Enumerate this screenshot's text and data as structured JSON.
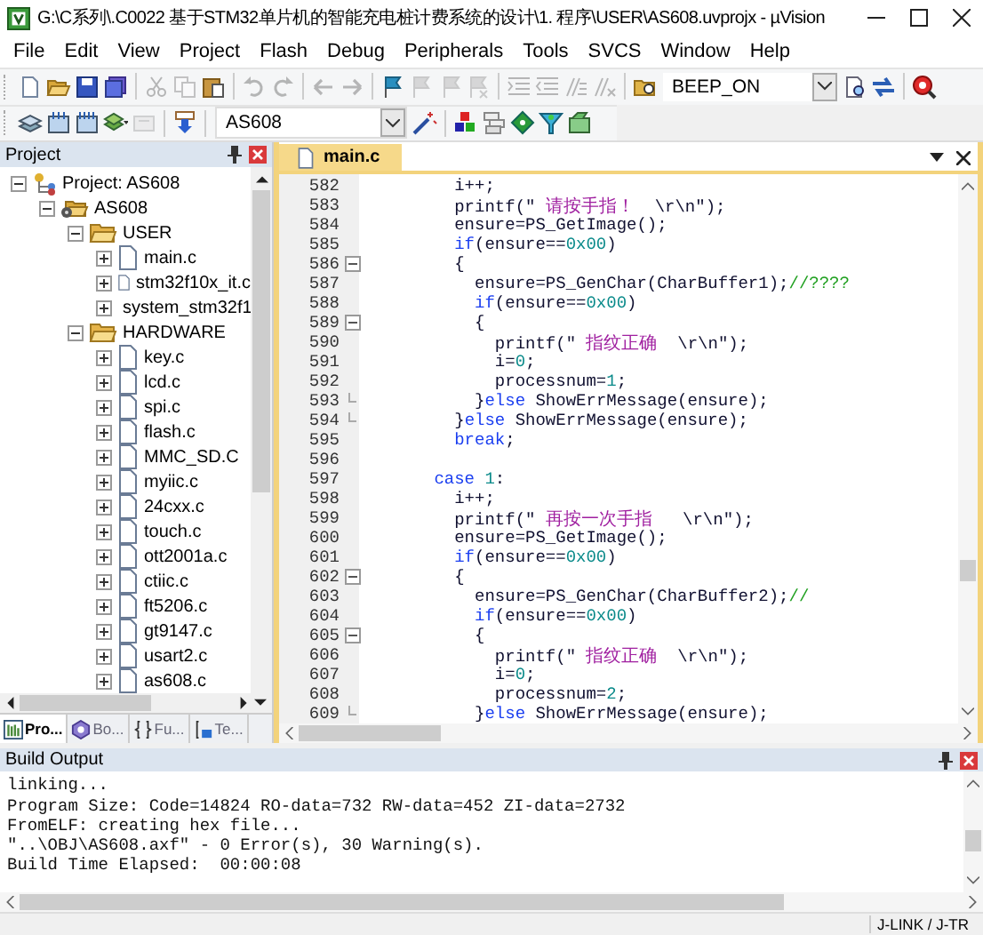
{
  "window": {
    "title": "G:\\C系列\\.C0022 基于STM32单片机的智能充电桩计费系统的设计\\1. 程序\\USER\\AS608.uvprojx - µVision"
  },
  "menu": [
    "File",
    "Edit",
    "View",
    "Project",
    "Flash",
    "Debug",
    "Peripherals",
    "Tools",
    "SVCS",
    "Window",
    "Help"
  ],
  "toolbar_1": [
    {
      "kind": "button",
      "disabled": false
    },
    {
      "kind": "button",
      "disabled": false
    },
    {
      "kind": "button",
      "disabled": false
    },
    {
      "kind": "button",
      "disabled": false
    },
    {
      "kind": "separator"
    },
    {
      "kind": "button",
      "disabled": true
    },
    {
      "kind": "button",
      "disabled": true
    },
    {
      "kind": "button",
      "disabled": false
    },
    {
      "kind": "separator"
    },
    {
      "kind": "button",
      "disabled": true
    },
    {
      "kind": "button",
      "disabled": true
    },
    {
      "kind": "separator"
    },
    {
      "kind": "button",
      "disabled": true
    },
    {
      "kind": "button",
      "disabled": true
    },
    {
      "kind": "separator"
    },
    {
      "kind": "button",
      "disabled": false
    },
    {
      "kind": "button",
      "disabled": true
    },
    {
      "kind": "button",
      "disabled": true
    },
    {
      "kind": "button",
      "disabled": true
    },
    {
      "kind": "separator"
    },
    {
      "kind": "button",
      "disabled": true
    },
    {
      "kind": "button",
      "disabled": true
    },
    {
      "kind": "button",
      "disabled": true
    },
    {
      "kind": "button",
      "disabled": true
    },
    {
      "kind": "separator"
    },
    {
      "kind": "button",
      "disabled": false
    },
    {
      "kind": "combo",
      "value": "BEEP_ON"
    },
    {
      "kind": "button",
      "disabled": false
    },
    {
      "kind": "button",
      "disabled": false
    },
    {
      "kind": "separator"
    },
    {
      "kind": "button",
      "disabled": false
    }
  ],
  "toolbar_2": [
    {
      "kind": "button",
      "disabled": false
    },
    {
      "kind": "button",
      "disabled": false
    },
    {
      "kind": "button",
      "disabled": false
    },
    {
      "kind": "button",
      "disabled": false
    },
    {
      "kind": "button",
      "disabled": true
    },
    {
      "kind": "separator"
    },
    {
      "kind": "button",
      "disabled": false
    },
    {
      "kind": "separator"
    },
    {
      "kind": "combo",
      "value": "AS608"
    },
    {
      "kind": "button",
      "disabled": false
    },
    {
      "kind": "separator"
    },
    {
      "kind": "button",
      "disabled": false
    },
    {
      "kind": "button",
      "disabled": false
    },
    {
      "kind": "button",
      "disabled": false
    },
    {
      "kind": "button",
      "disabled": false
    },
    {
      "kind": "button",
      "disabled": false
    }
  ],
  "project_panel": {
    "title": "Project",
    "tree": [
      {
        "label": "Project: AS608",
        "kind": "project",
        "expanded": true,
        "children": [
          {
            "label": "AS608",
            "kind": "target",
            "expanded": true,
            "children": [
              {
                "label": "USER",
                "kind": "folder",
                "expanded": true,
                "children": [
                  {
                    "label": "main.c",
                    "kind": "file",
                    "expanded": false
                  },
                  {
                    "label": "stm32f10x_it.c",
                    "kind": "file",
                    "expanded": false
                  },
                  {
                    "label": "system_stm32f1",
                    "kind": "file",
                    "expanded": false
                  }
                ]
              },
              {
                "label": "HARDWARE",
                "kind": "folder",
                "expanded": true,
                "children": [
                  {
                    "label": "key.c",
                    "kind": "file",
                    "expanded": false
                  },
                  {
                    "label": "lcd.c",
                    "kind": "file",
                    "expanded": false
                  },
                  {
                    "label": "spi.c",
                    "kind": "file",
                    "expanded": false
                  },
                  {
                    "label": "flash.c",
                    "kind": "file",
                    "expanded": false
                  },
                  {
                    "label": "MMC_SD.C",
                    "kind": "file",
                    "expanded": false
                  },
                  {
                    "label": "myiic.c",
                    "kind": "file",
                    "expanded": false
                  },
                  {
                    "label": "24cxx.c",
                    "kind": "file",
                    "expanded": false
                  },
                  {
                    "label": "touch.c",
                    "kind": "file",
                    "expanded": false
                  },
                  {
                    "label": "ott2001a.c",
                    "kind": "file",
                    "expanded": false
                  },
                  {
                    "label": "ctiic.c",
                    "kind": "file",
                    "expanded": false
                  },
                  {
                    "label": "ft5206.c",
                    "kind": "file",
                    "expanded": false
                  },
                  {
                    "label": "gt9147.c",
                    "kind": "file",
                    "expanded": false
                  },
                  {
                    "label": "usart2.c",
                    "kind": "file",
                    "expanded": false
                  },
                  {
                    "label": "as608.c",
                    "kind": "file",
                    "expanded": false
                  }
                ]
              }
            ]
          }
        ]
      }
    ],
    "tabs": [
      {
        "label": "Pro...",
        "selected": true
      },
      {
        "label": "Bo...",
        "selected": false
      },
      {
        "label": "Fu...",
        "selected": false
      },
      {
        "label": "Te...",
        "selected": false
      }
    ]
  },
  "editor": {
    "tabs": [
      {
        "label": "main.c",
        "selected": true
      }
    ],
    "lines": [
      {
        "number": "582",
        "fold_open": false,
        "fold_end": false,
        "segments": [
          {
            "text": "        i++;",
            "kind": "plain"
          }
        ]
      },
      {
        "number": "583",
        "fold_open": false,
        "fold_end": false,
        "segments": [
          {
            "text": "        printf(\" ",
            "kind": "plain"
          },
          {
            "text": "请按手指！",
            "kind": "string"
          },
          {
            "text": "  \\r\\n\");",
            "kind": "plain"
          }
        ]
      },
      {
        "number": "584",
        "fold_open": false,
        "fold_end": false,
        "segments": [
          {
            "text": "        ensure=PS_GetImage();",
            "kind": "plain"
          }
        ]
      },
      {
        "number": "585",
        "fold_open": false,
        "fold_end": false,
        "segments": [
          {
            "text": "        if",
            "kind": "keyword"
          },
          {
            "text": "(ensure==",
            "kind": "plain"
          },
          {
            "text": "0x00",
            "kind": "number"
          },
          {
            "text": ")",
            "kind": "plain"
          }
        ]
      },
      {
        "number": "586",
        "fold_open": true,
        "fold_end": false,
        "segments": [
          {
            "text": "        {",
            "kind": "plain"
          }
        ]
      },
      {
        "number": "587",
        "fold_open": false,
        "fold_end": false,
        "segments": [
          {
            "text": "          ensure=PS_GenChar(CharBuffer1);",
            "kind": "plain"
          },
          {
            "text": "//????",
            "kind": "comment"
          }
        ]
      },
      {
        "number": "588",
        "fold_open": false,
        "fold_end": false,
        "segments": [
          {
            "text": "          if",
            "kind": "keyword"
          },
          {
            "text": "(ensure==",
            "kind": "plain"
          },
          {
            "text": "0x00",
            "kind": "number"
          },
          {
            "text": ")",
            "kind": "plain"
          }
        ]
      },
      {
        "number": "589",
        "fold_open": true,
        "fold_end": false,
        "segments": [
          {
            "text": "          {",
            "kind": "plain"
          }
        ]
      },
      {
        "number": "590",
        "fold_open": false,
        "fold_end": false,
        "segments": [
          {
            "text": "            printf(\" ",
            "kind": "plain"
          },
          {
            "text": "指纹正确",
            "kind": "string"
          },
          {
            "text": "  \\r\\n\");",
            "kind": "plain"
          }
        ]
      },
      {
        "number": "591",
        "fold_open": false,
        "fold_end": false,
        "segments": [
          {
            "text": "            i=",
            "kind": "plain"
          },
          {
            "text": "0",
            "kind": "number"
          },
          {
            "text": ";",
            "kind": "plain"
          }
        ]
      },
      {
        "number": "592",
        "fold_open": false,
        "fold_end": false,
        "segments": [
          {
            "text": "            processnum=",
            "kind": "plain"
          },
          {
            "text": "1",
            "kind": "number"
          },
          {
            "text": ";",
            "kind": "plain"
          }
        ]
      },
      {
        "number": "593",
        "fold_open": false,
        "fold_end": true,
        "segments": [
          {
            "text": "          }",
            "kind": "plain"
          },
          {
            "text": "else",
            "kind": "keyword"
          },
          {
            "text": " ShowErrMessage(ensure);",
            "kind": "plain"
          }
        ]
      },
      {
        "number": "594",
        "fold_open": false,
        "fold_end": true,
        "segments": [
          {
            "text": "        }",
            "kind": "plain"
          },
          {
            "text": "else",
            "kind": "keyword"
          },
          {
            "text": " ShowErrMessage(ensure);",
            "kind": "plain"
          }
        ]
      },
      {
        "number": "595",
        "fold_open": false,
        "fold_end": false,
        "segments": [
          {
            "text": "        break",
            "kind": "keyword"
          },
          {
            "text": ";",
            "kind": "plain"
          }
        ]
      },
      {
        "number": "596",
        "fold_open": false,
        "fold_end": false
      },
      {
        "number": "597",
        "fold_open": false,
        "fold_end": false,
        "segments": [
          {
            "text": "      case ",
            "kind": "keyword"
          },
          {
            "text": "1",
            "kind": "number"
          },
          {
            "text": ":",
            "kind": "plain"
          }
        ]
      },
      {
        "number": "598",
        "fold_open": false,
        "fold_end": false,
        "segments": [
          {
            "text": "        i++;",
            "kind": "plain"
          }
        ]
      },
      {
        "number": "599",
        "fold_open": false,
        "fold_end": false,
        "segments": [
          {
            "text": "        printf(\" ",
            "kind": "plain"
          },
          {
            "text": "再按一次手指",
            "kind": "string"
          },
          {
            "text": "   \\r\\n\");",
            "kind": "plain"
          }
        ]
      },
      {
        "number": "600",
        "fold_open": false,
        "fold_end": false,
        "segments": [
          {
            "text": "        ensure=PS_GetImage();",
            "kind": "plain"
          }
        ]
      },
      {
        "number": "601",
        "fold_open": false,
        "fold_end": false,
        "segments": [
          {
            "text": "        if",
            "kind": "keyword"
          },
          {
            "text": "(ensure==",
            "kind": "plain"
          },
          {
            "text": "0x00",
            "kind": "number"
          },
          {
            "text": ")",
            "kind": "plain"
          }
        ]
      },
      {
        "number": "602",
        "fold_open": true,
        "fold_end": false,
        "segments": [
          {
            "text": "        {",
            "kind": "plain"
          }
        ]
      },
      {
        "number": "603",
        "fold_open": false,
        "fold_end": false,
        "segments": [
          {
            "text": "          ensure=PS_GenChar(CharBuffer2);",
            "kind": "plain"
          },
          {
            "text": "//",
            "kind": "comment"
          }
        ]
      },
      {
        "number": "604",
        "fold_open": false,
        "fold_end": false,
        "segments": [
          {
            "text": "          if",
            "kind": "keyword"
          },
          {
            "text": "(ensure==",
            "kind": "plain"
          },
          {
            "text": "0x00",
            "kind": "number"
          },
          {
            "text": ")",
            "kind": "plain"
          }
        ]
      },
      {
        "number": "605",
        "fold_open": true,
        "fold_end": false,
        "segments": [
          {
            "text": "          {",
            "kind": "plain"
          }
        ]
      },
      {
        "number": "606",
        "fold_open": false,
        "fold_end": false,
        "segments": [
          {
            "text": "            printf(\" ",
            "kind": "plain"
          },
          {
            "text": "指纹正确",
            "kind": "string"
          },
          {
            "text": "  \\r\\n\");",
            "kind": "plain"
          }
        ]
      },
      {
        "number": "607",
        "fold_open": false,
        "fold_end": false,
        "segments": [
          {
            "text": "            i=",
            "kind": "plain"
          },
          {
            "text": "0",
            "kind": "number"
          },
          {
            "text": ";",
            "kind": "plain"
          }
        ]
      },
      {
        "number": "608",
        "fold_open": false,
        "fold_end": false,
        "segments": [
          {
            "text": "            processnum=",
            "kind": "plain"
          },
          {
            "text": "2",
            "kind": "number"
          },
          {
            "text": ";",
            "kind": "plain"
          }
        ]
      },
      {
        "number": "609",
        "fold_open": false,
        "fold_end": true,
        "segments": [
          {
            "text": "          }",
            "kind": "plain"
          },
          {
            "text": "else",
            "kind": "keyword"
          },
          {
            "text": " ShowErrMessage(ensure);",
            "kind": "plain"
          }
        ]
      }
    ]
  },
  "build_output": {
    "title": "Build Output",
    "lines": [
      "linking...",
      "Program Size: Code=14824 RO-data=732 RW-data=452 ZI-data=2732",
      "FromELF: creating hex file...",
      "\"..\\OBJ\\AS608.axf\" - 0 Error(s), 30 Warning(s).",
      "Build Time Elapsed:  00:00:08"
    ]
  },
  "status_bar": {
    "debugger": "J-LINK / J-TR"
  }
}
